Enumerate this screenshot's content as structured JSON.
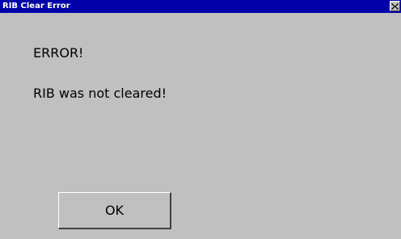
{
  "window": {
    "title": "RIB Clear Error"
  },
  "message": {
    "heading": "ERROR!",
    "detail": "RIB was not cleared!"
  },
  "buttons": {
    "ok_label": "OK"
  },
  "icons": {
    "close": "close-icon"
  },
  "colors": {
    "titlebar": "#0000a8",
    "background": "#c0c0c0",
    "title_text": "#ffffff"
  }
}
